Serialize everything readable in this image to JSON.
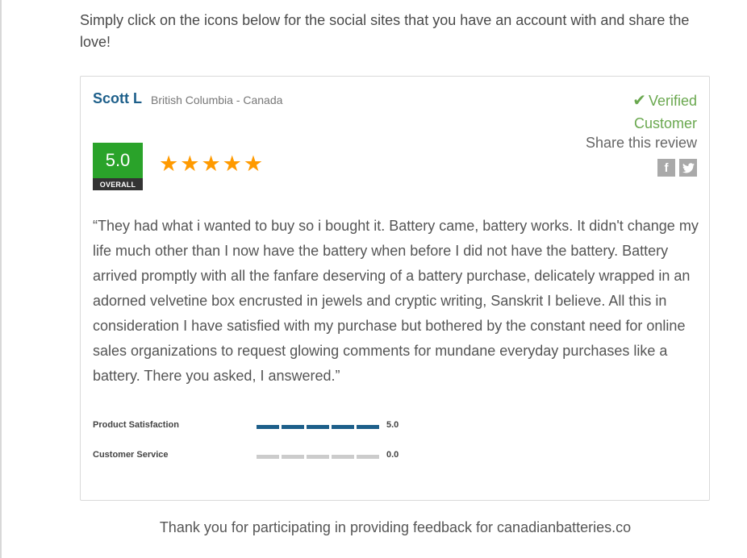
{
  "intro_text": "Simply click on the icons below for the social sites that you have an account with and share the love!",
  "review": {
    "reviewer_name": "Scott L",
    "location": "British Columbia - Canada",
    "verified_check": "✔",
    "verified_line1": "Verified",
    "verified_line2": "Customer",
    "share_label": "Share this review",
    "share_icons": [
      "facebook-icon",
      "twitter-icon"
    ],
    "overall_score": "5.0",
    "overall_label": "OVERALL",
    "star_rating": 5,
    "star_color": "#ff9a00",
    "text": "“They had what i wanted to buy so i bought it. Battery came, battery works. It didn't change my life much other than I now have the battery when before I did not have the battery. Battery arrived promptly with all the fanfare deserving of a battery purchase, delicately wrapped in an adorned velvetine box encrusted in jewels and cryptic writing, Sanskrit I believe. All this in consideration I have satisfied with my purchase but bothered by the constant need for online sales organizations to request glowing comments for mundane everyday purchases like a battery. There you asked, I answered.”",
    "metrics": [
      {
        "label": "Product Satisfaction",
        "value": "5.0",
        "filled_segments": 5
      },
      {
        "label": "Customer Service",
        "value": "0.0",
        "filled_segments": 0
      }
    ]
  },
  "colors": {
    "score_green": "#2aa32a",
    "verified_green": "#6aa84f",
    "name_blue": "#1d5f8a",
    "bar_filled": "#1d5f8a",
    "bar_empty": "#cccccc"
  },
  "footer_text": "Thank you for participating in providing feedback for canadianbatteries.co"
}
